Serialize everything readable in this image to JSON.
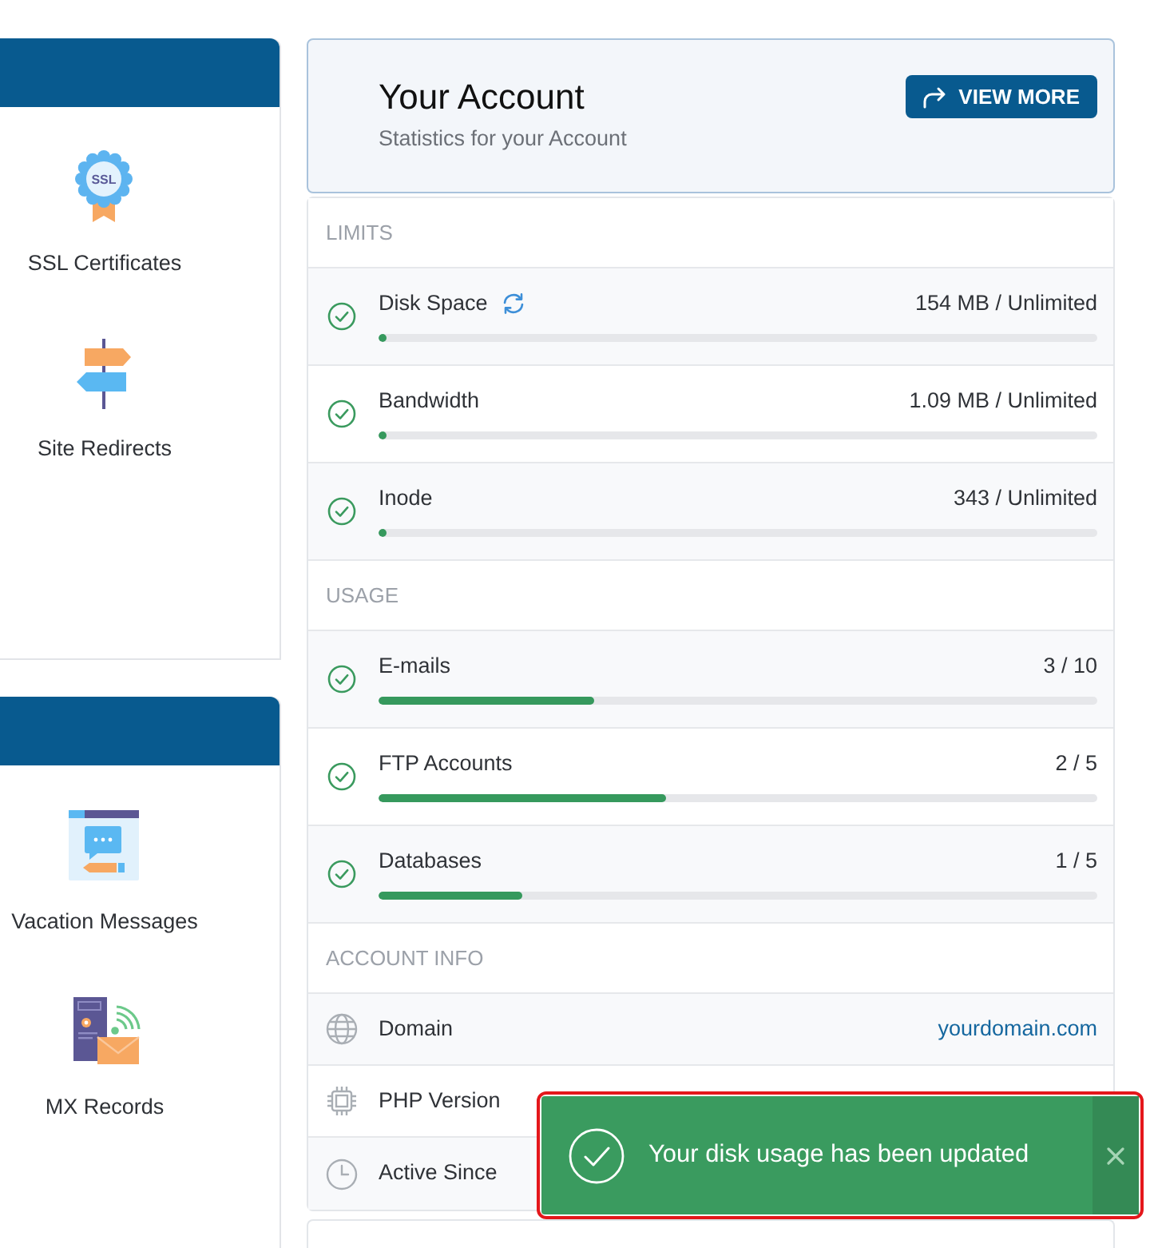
{
  "sidebar_panels": [
    {
      "items": [
        {
          "kind": "certificate",
          "label": "SSL Certificates",
          "badge_text": "SSL"
        },
        {
          "kind": "signpost",
          "label": "Site Redirects"
        }
      ]
    },
    {
      "items": [
        {
          "kind": "message",
          "label": "Vacation Messages"
        },
        {
          "kind": "server",
          "label": "MX Records"
        }
      ]
    }
  ],
  "account": {
    "title": "Your Account",
    "subtitle": "Statistics for your Account",
    "button": "VIEW MORE"
  },
  "sections": [
    {
      "heading": "LIMITS",
      "rows": [
        {
          "kind": "meter",
          "label": "Disk Space",
          "refresh": true,
          "value": "154 MB / Unlimited",
          "level": 0.01
        },
        {
          "kind": "meter",
          "label": "Bandwidth",
          "refresh": false,
          "value": "1.09 MB / Unlimited",
          "level": 0.01
        },
        {
          "kind": "meter",
          "label": "Inode",
          "refresh": false,
          "value": "343 / Unlimited",
          "level": 0.01
        }
      ]
    },
    {
      "heading": "USAGE",
      "rows": [
        {
          "kind": "meter",
          "label": "E-mails",
          "refresh": false,
          "value": "3 / 10",
          "level": 0.3
        },
        {
          "kind": "meter",
          "label": "FTP Accounts",
          "refresh": false,
          "value": "2 / 5",
          "level": 0.4
        },
        {
          "kind": "meter",
          "label": "Databases",
          "refresh": false,
          "value": "1 / 5",
          "level": 0.2
        }
      ]
    },
    {
      "heading": "ACCOUNT INFO",
      "rows": [
        {
          "kind": "info",
          "label": "Domain",
          "value": "yourdomain.com"
        },
        {
          "kind": "info",
          "label": "PHP Version"
        },
        {
          "kind": "info",
          "label": "Active Since"
        }
      ]
    }
  ],
  "toast": {
    "message": "Your disk usage has been updated",
    "highlighted": true
  }
}
